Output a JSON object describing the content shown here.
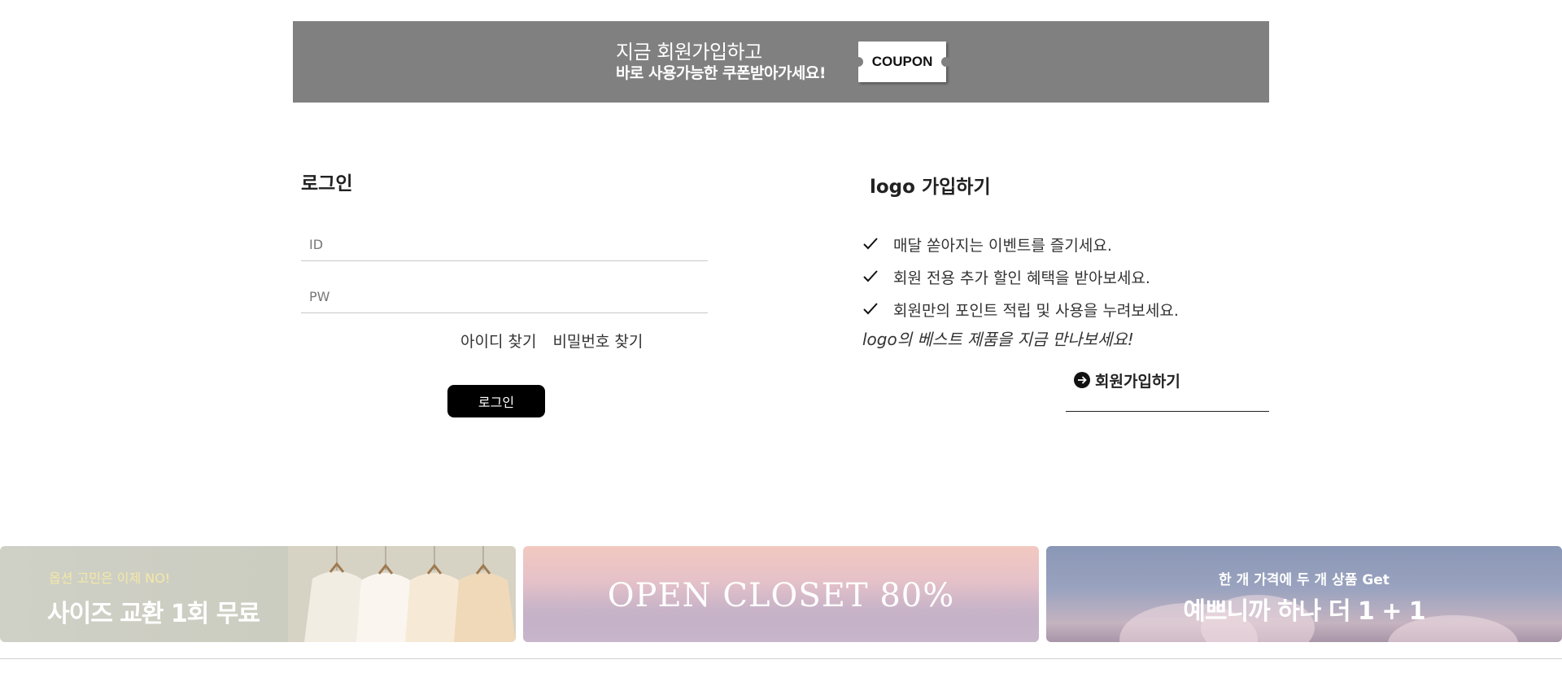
{
  "coupon_banner": {
    "line1": "지금 회원가입하고",
    "line2": "바로 사용가능한 쿠폰받아가세요!",
    "coupon_label": "COUPON",
    "background": "#808080"
  },
  "login": {
    "title": "로그인",
    "id_placeholder": "ID",
    "pw_placeholder": "PW",
    "find_id": "아이디 찾기",
    "find_pw": "비밀번호 찾기",
    "submit": "로그인"
  },
  "join": {
    "title": "logo 가입하기",
    "benefits": [
      "매달 쏟아지는 이벤트를 즐기세요.",
      "회원 전용 추가 할인 혜택을 받아보세요.",
      "회원만의 포인트 적립 및 사용을 누려보세요."
    ],
    "note": "logo의 베스트 제품을 지금 만나보세요!",
    "link": "회원가입하기",
    "link_icon": "arrow-circle-right-icon",
    "check_icon": "check-icon"
  },
  "promos": [
    {
      "sub": "옵션 고민은 이제 NO!",
      "main": "사이즈 교환 1회 무료"
    },
    {
      "main": "OPEN CLOSET 80%"
    },
    {
      "sub": "한 개 가격에 두 개 상품 Get",
      "main": "예쁘니까 하나 더 1 + 1"
    }
  ]
}
